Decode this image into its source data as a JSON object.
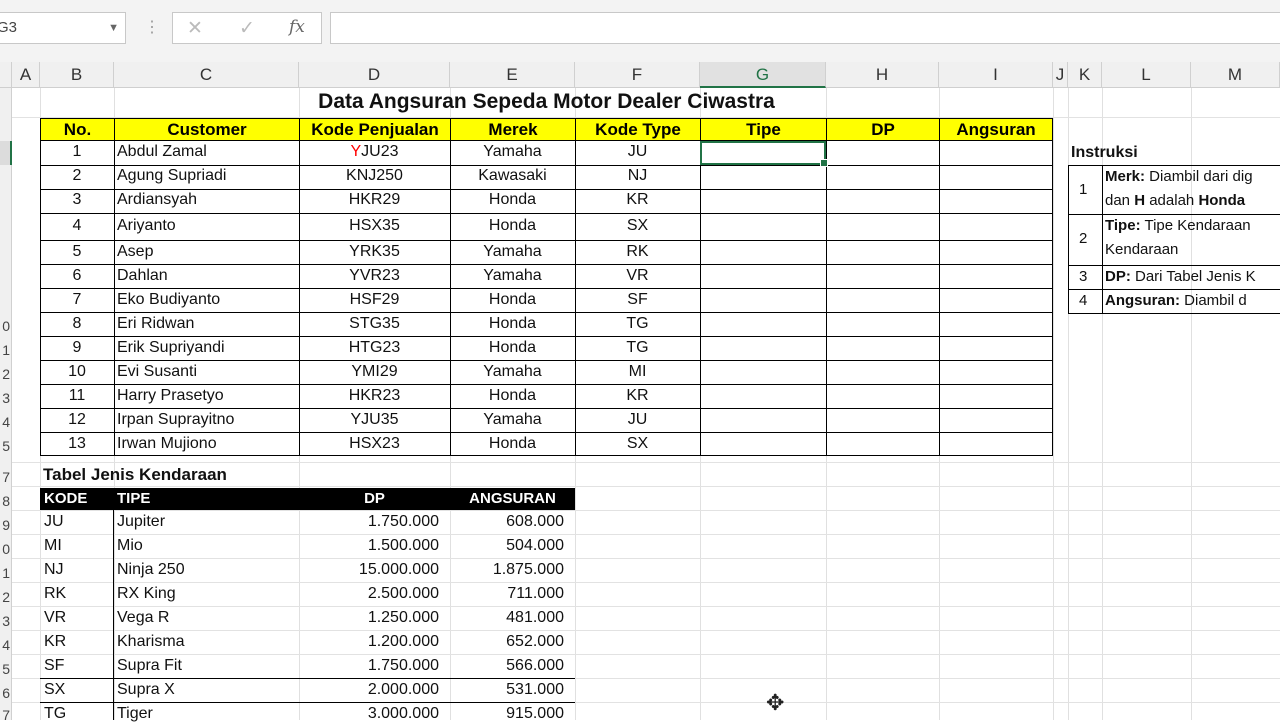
{
  "formula_bar": {
    "name_box": "G3",
    "cancel_icon": "✕",
    "enter_icon": "✓",
    "fx_label": "fx",
    "formula": ""
  },
  "columns": [
    "A",
    "B",
    "C",
    "D",
    "E",
    "F",
    "G",
    "H",
    "I",
    "J",
    "K",
    "L",
    "M"
  ],
  "row_numbers": [
    "",
    "",
    "",
    "",
    "",
    "",
    "",
    "",
    "0",
    "1",
    "2",
    "3",
    "4",
    "5",
    "",
    "7",
    "8",
    "9",
    "0",
    "1",
    "2",
    "3",
    "4",
    "5",
    "6",
    "7"
  ],
  "title": "Data Angsuran Sepeda Motor Dealer Ciwastra",
  "table_headers": [
    "No.",
    "Customer",
    "Kode Penjualan",
    "Merek",
    "Kode Type",
    "Tipe",
    "DP",
    "Angsuran"
  ],
  "rows": [
    {
      "no": "1",
      "customer": "Abdul Zamal",
      "kode": "YJU23",
      "merek": "Yamaha",
      "type": "JU"
    },
    {
      "no": "2",
      "customer": "Agung Supriadi",
      "kode": "KNJ250",
      "merek": "Kawasaki",
      "type": "NJ"
    },
    {
      "no": "3",
      "customer": "Ardiansyah",
      "kode": "HKR29",
      "merek": "Honda",
      "type": "KR"
    },
    {
      "no": "4",
      "customer": "Ariyanto",
      "kode": "HSX35",
      "merek": "Honda",
      "type": "SX"
    },
    {
      "no": "5",
      "customer": "Asep",
      "kode": "YRK35",
      "merek": "Yamaha",
      "type": "RK"
    },
    {
      "no": "6",
      "customer": "Dahlan",
      "kode": "YVR23",
      "merek": "Yamaha",
      "type": "VR"
    },
    {
      "no": "7",
      "customer": "Eko Budiyanto",
      "kode": "HSF29",
      "merek": "Honda",
      "type": "SF"
    },
    {
      "no": "8",
      "customer": "Eri Ridwan",
      "kode": "STG35",
      "merek": "Honda",
      "type": "TG"
    },
    {
      "no": "9",
      "customer": "Erik Supriyandi",
      "kode": "HTG23",
      "merek": "Honda",
      "type": "TG"
    },
    {
      "no": "10",
      "customer": "Evi Susanti",
      "kode": "YMI29",
      "merek": "Yamaha",
      "type": "MI"
    },
    {
      "no": "11",
      "customer": "Harry Prasetyo",
      "kode": "HKR23",
      "merek": "Honda",
      "type": "KR"
    },
    {
      "no": "12",
      "customer": "Irpan Suprayitno",
      "kode": "YJU35",
      "merek": "Yamaha",
      "type": "JU"
    },
    {
      "no": "13",
      "customer": "Irwan Mujiono",
      "kode": "HSX23",
      "merek": "Honda",
      "type": "SX"
    }
  ],
  "ref_table": {
    "title": "Tabel Jenis Kendaraan",
    "headers": [
      "KODE",
      "TIPE",
      "DP",
      "ANGSURAN"
    ],
    "rows": [
      {
        "kode": "JU",
        "tipe": "Jupiter",
        "dp": "1.750.000",
        "angsuran": "608.000"
      },
      {
        "kode": "MI",
        "tipe": "Mio",
        "dp": "1.500.000",
        "angsuran": "504.000"
      },
      {
        "kode": "NJ",
        "tipe": "Ninja 250",
        "dp": "15.000.000",
        "angsuran": "1.875.000"
      },
      {
        "kode": "RK",
        "tipe": "RX King",
        "dp": "2.500.000",
        "angsuran": "711.000"
      },
      {
        "kode": "VR",
        "tipe": "Vega R",
        "dp": "1.250.000",
        "angsuran": "481.000"
      },
      {
        "kode": "KR",
        "tipe": "Kharisma",
        "dp": "1.200.000",
        "angsuran": "652.000"
      },
      {
        "kode": "SF",
        "tipe": "Supra Fit",
        "dp": "1.750.000",
        "angsuran": "566.000"
      },
      {
        "kode": "SX",
        "tipe": "Supra X",
        "dp": "2.000.000",
        "angsuran": "531.000"
      },
      {
        "kode": "TG",
        "tipe": "Tiger",
        "dp": "3.000.000",
        "angsuran": "915.000"
      }
    ]
  },
  "instructions": {
    "title": "Instruksi",
    "items": [
      {
        "num": "1",
        "bold": "Merk:",
        "text": " Diambil dari dig",
        "line2_pre": "dan ",
        "line2_b1": "H",
        "line2_mid": " adalah ",
        "line2_b2": "Honda"
      },
      {
        "num": "2",
        "bold": "Tipe:",
        "text": " Tipe Kendaraan",
        "line2": "Kendaraan"
      },
      {
        "num": "3",
        "bold": "DP:",
        "text": " Dari Tabel Jenis K"
      },
      {
        "num": "4",
        "bold": "Angsuran:",
        "text": " Diambil d"
      }
    ]
  },
  "colors": {
    "header_yellow": "#ffff00",
    "selection_green": "#217346",
    "kode_red": "#ff0000"
  }
}
